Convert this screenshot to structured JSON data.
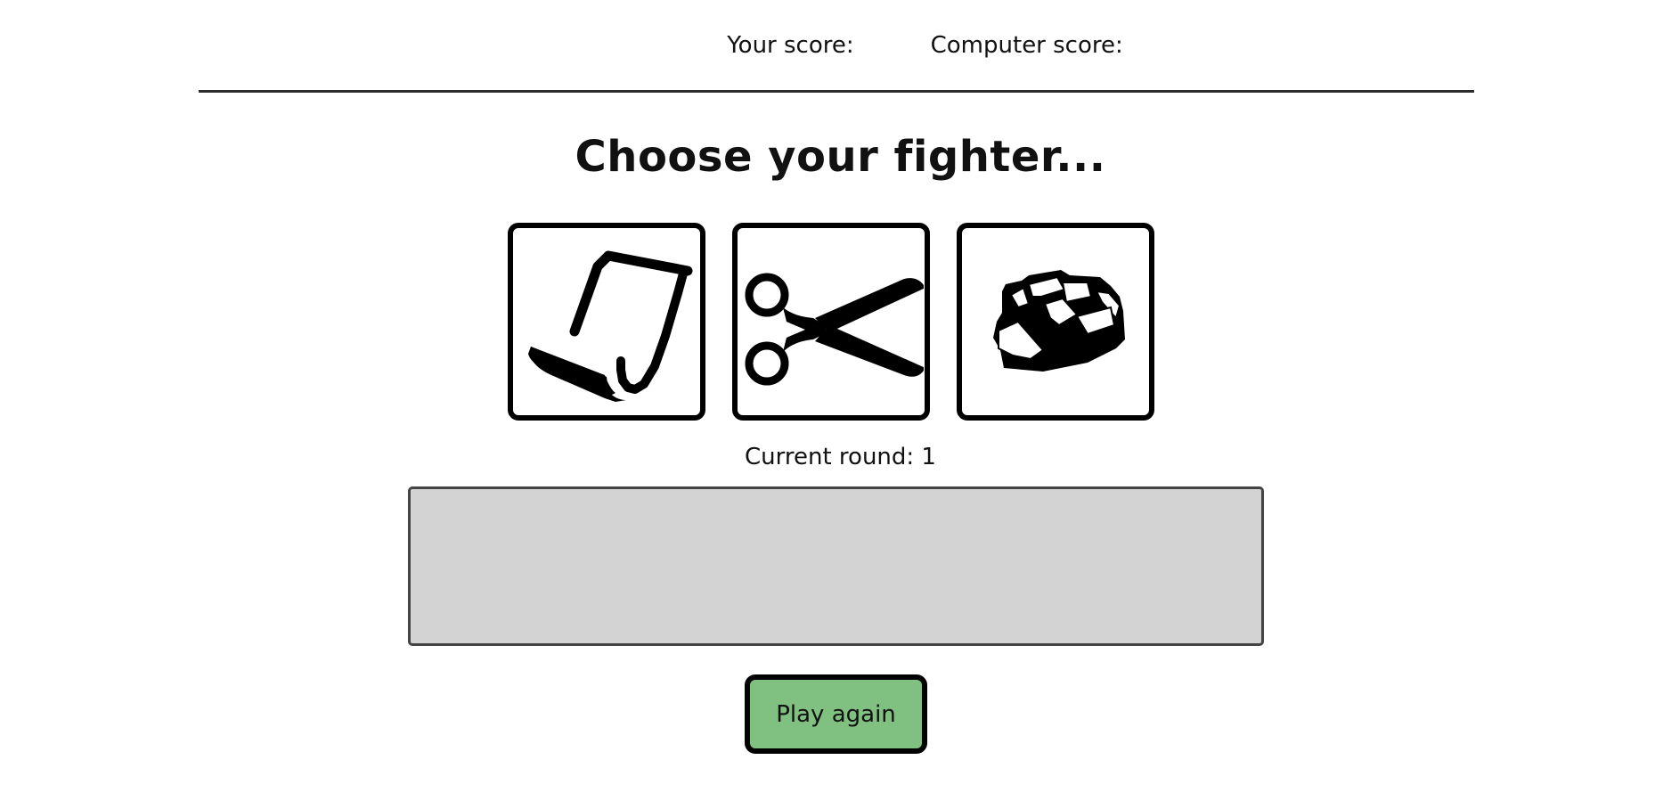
{
  "scoreboard": {
    "player_label": "Your score:",
    "player_value": "",
    "computer_label": "Computer score:",
    "computer_value": ""
  },
  "heading": "Choose your fighter...",
  "fighters": [
    {
      "name": "paper",
      "icon": "paper-icon"
    },
    {
      "name": "scissors",
      "icon": "scissors-icon"
    },
    {
      "name": "rock",
      "icon": "rock-icon"
    }
  ],
  "round": {
    "label": "Current round:",
    "value": "1",
    "text": "Current round: 1"
  },
  "result": {
    "text": ""
  },
  "play_again_label": "Play again",
  "colors": {
    "play_again_bg": "#80c080",
    "result_bg": "#d3d3d3",
    "border": "#000000",
    "divider": "#2d2d2d"
  }
}
